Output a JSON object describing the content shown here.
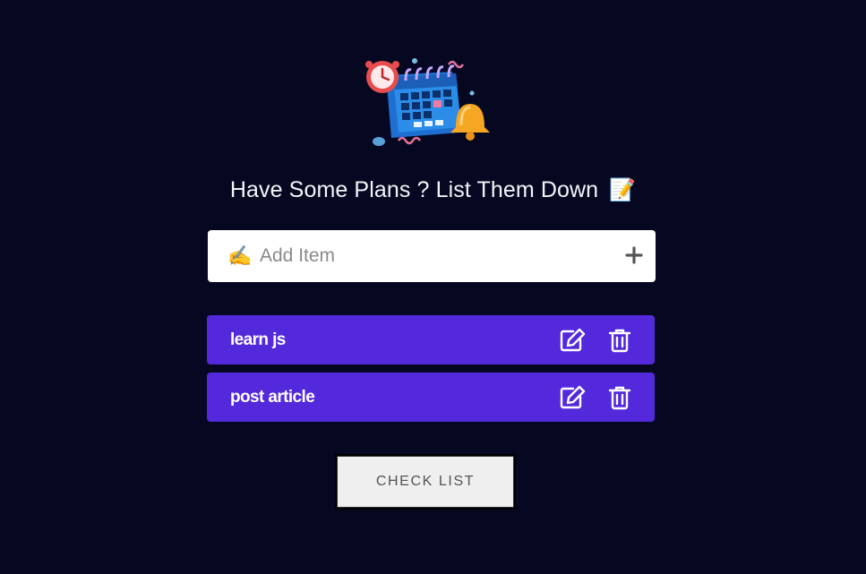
{
  "header": {
    "heading": "Have Some Plans ? List Them Down",
    "heading_emoji": "📝",
    "hero_icon": "calendar-alarm-bell-illustration"
  },
  "add_item": {
    "emoji": "✍️",
    "placeholder": "Add Item",
    "value": "",
    "add_icon": "plus-icon"
  },
  "items": [
    {
      "label": "learn js",
      "edit_icon": "edit-icon",
      "delete_icon": "trash-icon"
    },
    {
      "label": "post article",
      "edit_icon": "edit-icon",
      "delete_icon": "trash-icon"
    }
  ],
  "actions": {
    "check_list_label": "CHECK LIST"
  },
  "colors": {
    "background": "#060822",
    "item_bg": "#5429dc",
    "input_bg": "#ffffff",
    "button_bg": "#efefef"
  }
}
